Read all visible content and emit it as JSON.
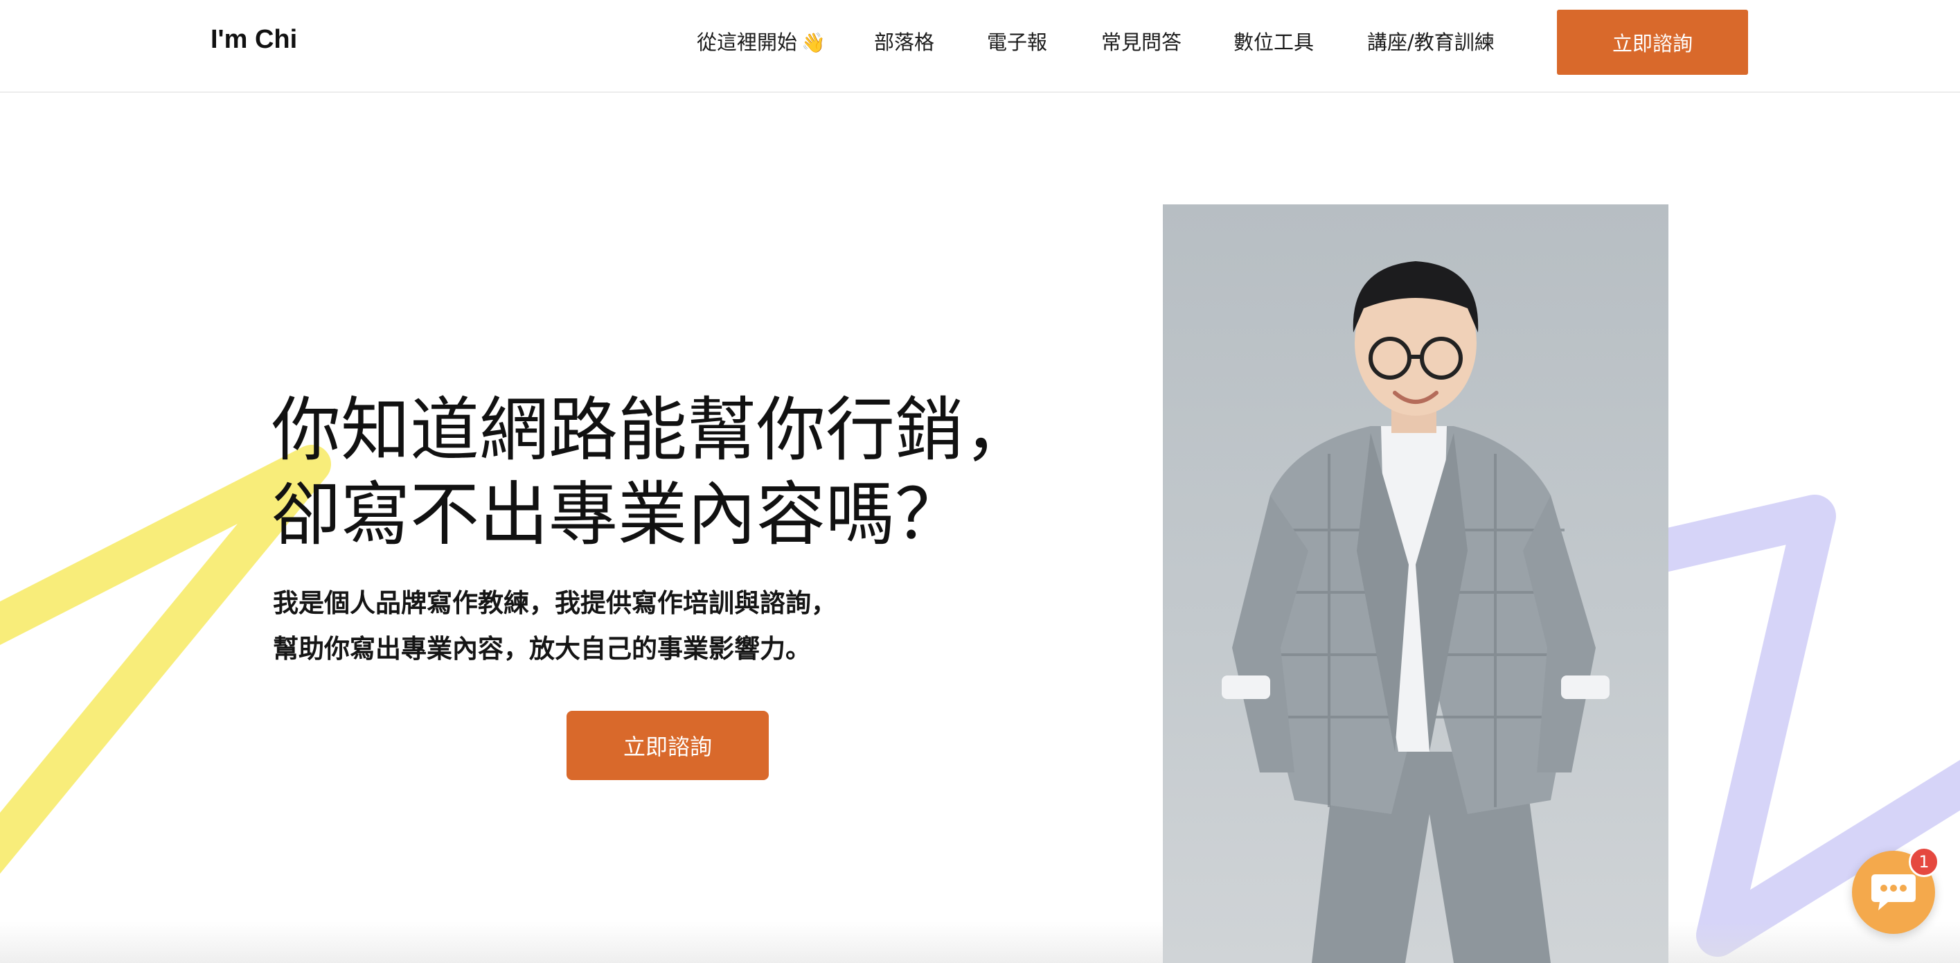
{
  "header": {
    "logo": "I'm Chi",
    "nav": [
      {
        "label": "從這裡開始",
        "icon": "👋"
      },
      {
        "label": "部落格"
      },
      {
        "label": "電子報"
      },
      {
        "label": "常見問答"
      },
      {
        "label": "數位工具"
      },
      {
        "label": "講座/教育訓練"
      }
    ],
    "cta_label": "立即諮詢"
  },
  "hero": {
    "title_lines": [
      "你知道網路能幫你行銷，",
      "卻寫不出專業內容嗎？"
    ],
    "subtitle_lines": [
      "我是個人品牌寫作教練，我提供寫作培訓與諮詢，",
      "幫助你寫出專業內容，放大自己的事業影響力。"
    ],
    "cta_label": "立即諮詢"
  },
  "chat": {
    "badge_count": "1"
  },
  "colors": {
    "accent": "#d9692b",
    "deco_yellow": "#f8ed7a",
    "deco_lavender": "#d6d4f8",
    "chat_bubble": "#f4a94c",
    "badge_red": "#e5483f"
  },
  "icons": {
    "wave": "waving-hand-icon",
    "chat": "chat-bubble-icon"
  }
}
